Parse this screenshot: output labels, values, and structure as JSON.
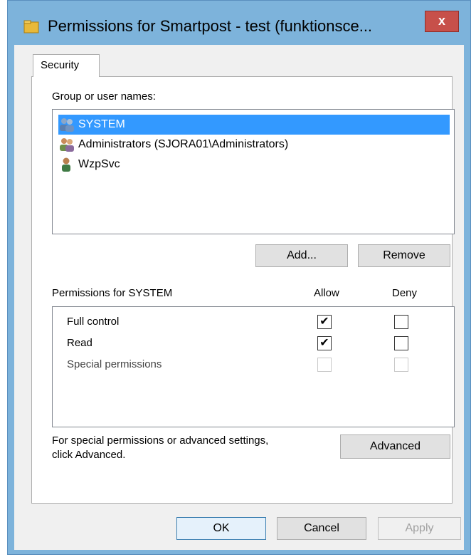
{
  "window": {
    "title": "Permissions for Smartpost - test (funktionsce...",
    "close_label": "x"
  },
  "tabs": [
    {
      "label": "Security",
      "active": true
    }
  ],
  "security": {
    "group_label": "Group or user names:",
    "users": [
      {
        "name": "SYSTEM",
        "icon": "system-users-icon",
        "selected": true
      },
      {
        "name": "Administrators (SJORA01\\Administrators)",
        "icon": "group-users-icon",
        "selected": false
      },
      {
        "name": "WzpSvc",
        "icon": "user-icon",
        "selected": false
      }
    ],
    "add_label": "Add...",
    "remove_label": "Remove",
    "permissions_label": "Permissions for SYSTEM",
    "allow_label": "Allow",
    "deny_label": "Deny",
    "permissions": [
      {
        "name": "Full control",
        "allow": true,
        "deny": false,
        "enabled": true
      },
      {
        "name": "Read",
        "allow": true,
        "deny": false,
        "enabled": true
      },
      {
        "name": "Special permissions",
        "allow": false,
        "deny": false,
        "enabled": false
      }
    ],
    "advanced_text_1": "For special permissions or advanced settings,",
    "advanced_text_2": "click Advanced.",
    "advanced_label": "Advanced"
  },
  "footer": {
    "ok_label": "OK",
    "cancel_label": "Cancel",
    "apply_label": "Apply"
  },
  "colors": {
    "frame": "#7db3db",
    "selection": "#3399ff",
    "close": "#c7504a"
  }
}
